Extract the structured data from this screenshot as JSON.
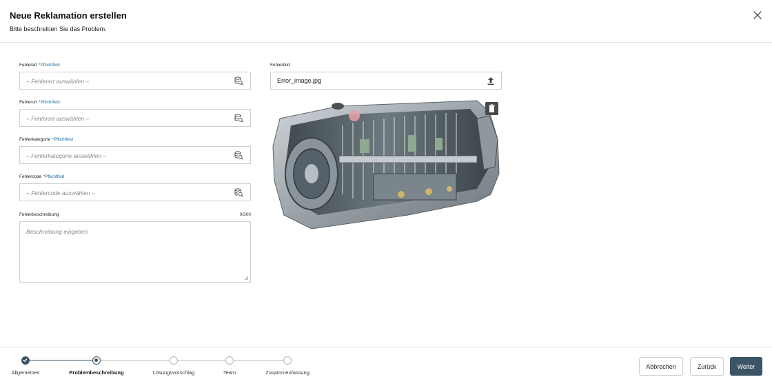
{
  "dialog": {
    "title": "Neue Reklamation erstellen",
    "subtitle": "Bitte beschreiben Sie das Problem."
  },
  "form": {
    "required_marker": "*Pflichtfeld",
    "fields": [
      {
        "label": "Fehlerart",
        "placeholder": "– Fehlerart auswählen –",
        "required": true
      },
      {
        "label": "Fehlerort",
        "placeholder": "– Fehlerort auswählen –",
        "required": true
      },
      {
        "label": "Fehlerkategorie",
        "placeholder": "– Fehlerkategorie auswählen –",
        "required": true
      },
      {
        "label": "Fehlercode",
        "placeholder": "– Fehlercode auswählen –",
        "required": true
      }
    ],
    "description": {
      "label": "Fehlerbeschreibung",
      "counter": "0/500",
      "placeholder": "Beschreibung eingeben"
    },
    "image": {
      "label": "Fehlerbild",
      "filename": "Error_image.jpg",
      "icons": {
        "upload": "upload-icon",
        "delete": "trash-icon"
      }
    }
  },
  "stepper": {
    "steps": [
      {
        "label": "Allgemeines",
        "state": "done"
      },
      {
        "label": "Problembeschreibung",
        "state": "active"
      },
      {
        "label": "Lösungsvorschlag",
        "state": "todo"
      },
      {
        "label": "Team",
        "state": "todo"
      },
      {
        "label": "Zusammenfassung",
        "state": "todo"
      }
    ]
  },
  "buttons": {
    "cancel": "Abbrechen",
    "back": "Zurück",
    "next": "Weiter"
  },
  "colors": {
    "primary": "#3b5466",
    "required_link": "#1a6fa3"
  }
}
